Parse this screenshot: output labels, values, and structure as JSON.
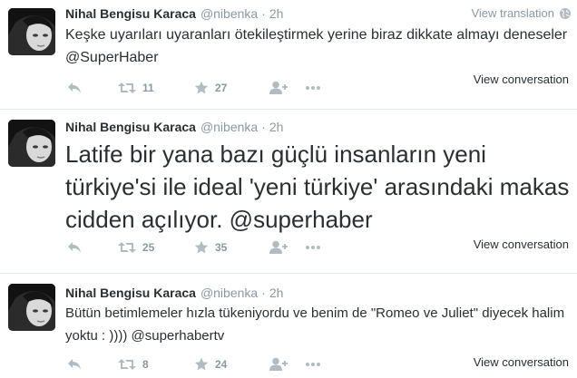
{
  "tweets": [
    {
      "fullname": "Nihal Bengisu Karaca",
      "username": "@nibenka",
      "separator": "·",
      "time": "2h",
      "view_translation": "View translation",
      "text": "Keşke uyarıları uyaranları ötekileştirmek yerine biraz dikkate almayı deneseler",
      "mention": "@SuperHaber",
      "retweets": "11",
      "favorites": "27",
      "view_conversation": "View conversation"
    },
    {
      "fullname": "Nihal Bengisu Karaca",
      "username": "@nibenka",
      "separator": "·",
      "time": "2h",
      "text": "Latife bir yana bazı güçlü insanların yeni türkiye'si ile ideal 'yeni türkiye' arasındaki makas cidden açılıyor.",
      "mention": "@superhaber",
      "retweets": "25",
      "favorites": "35",
      "view_conversation": "View conversation"
    },
    {
      "fullname": "Nihal Bengisu Karaca",
      "username": "@nibenka",
      "separator": "·",
      "time": "2h",
      "text": "Bütün betimlemeler hızla tükeniyordu ve benim de \"Romeo ve Juliet\" diyecek halim  yoktu : ))))",
      "mention": "@superhabertv",
      "retweets": "8",
      "favorites": "24",
      "view_conversation": "View conversation"
    }
  ],
  "icons": {
    "reply": "reply-icon",
    "retweet": "retweet-icon",
    "favorite": "star-icon",
    "follow": "follow-icon",
    "more": "more-icon",
    "globe": "globe-icon"
  },
  "colors": {
    "text": "#292f33",
    "muted": "#8899a6",
    "icon": "#b1bbc3",
    "divider": "#e1e8ed"
  }
}
